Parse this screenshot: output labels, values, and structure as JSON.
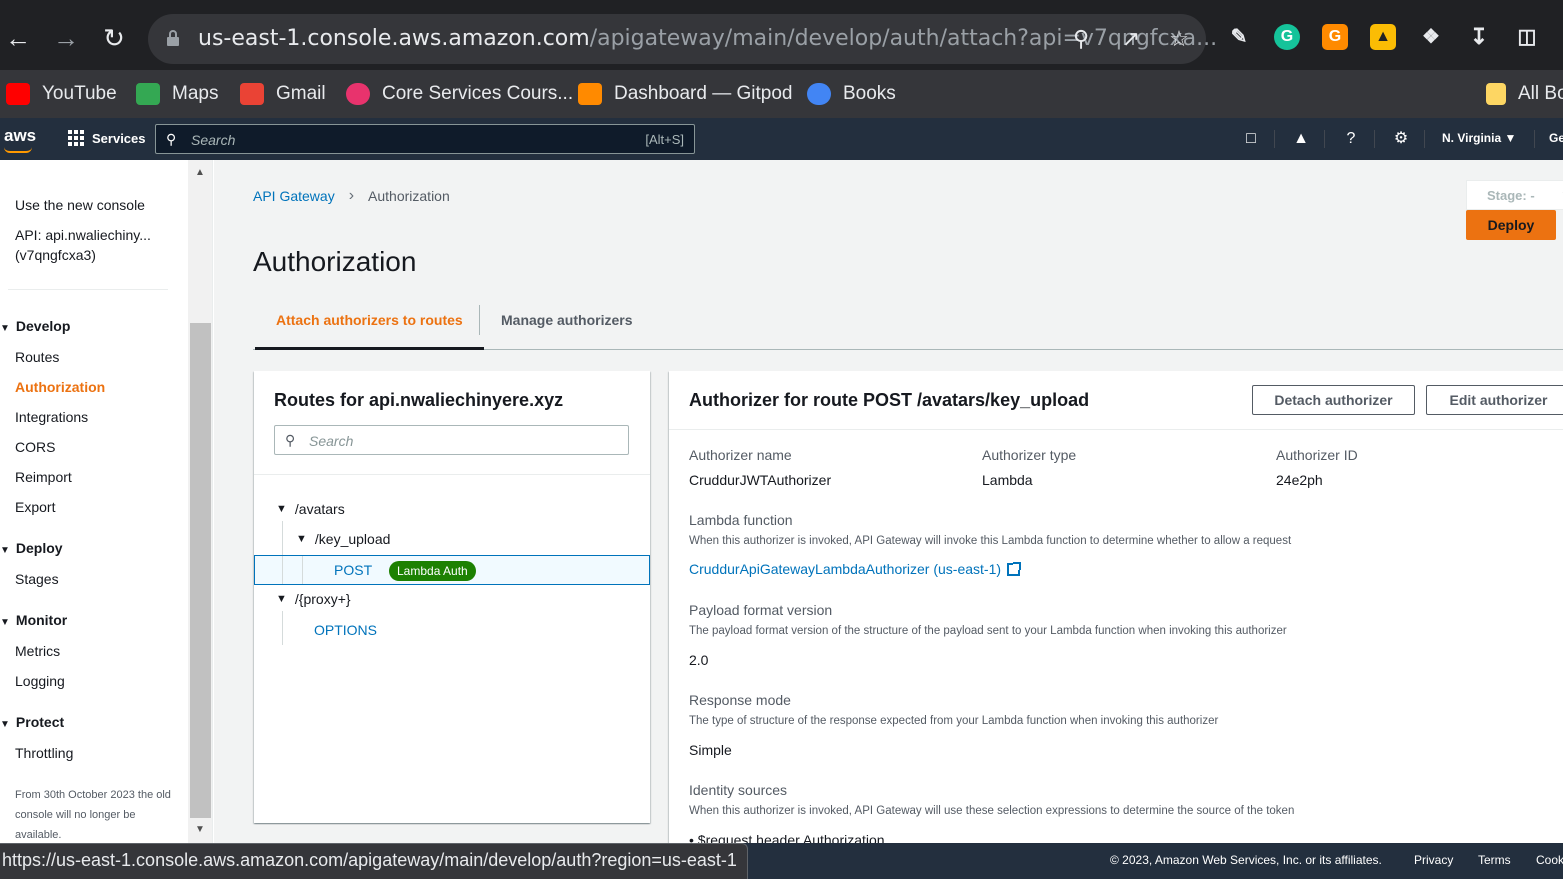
{
  "browser": {
    "url_host": "us-east-1.console.aws.amazon.com",
    "url_path": "/apigateway/main/develop/auth/attach?api=v7qngfcxa...",
    "status_url": "https://us-east-1.console.aws.amazon.com/apigateway/main/develop/auth?region=us-east-1"
  },
  "bookmarks": [
    {
      "label": "YouTube",
      "color": "#ff0000"
    },
    {
      "label": "Maps",
      "color": "#34a853"
    },
    {
      "label": "Gmail",
      "color": "#ea4335"
    },
    {
      "label": "Core Services Cours...",
      "color": "#e8336d"
    },
    {
      "label": "Dashboard — Gitpod",
      "color": "#ff8a00"
    },
    {
      "label": "Books",
      "color": "#4285f4"
    },
    {
      "label": "All Bo",
      "color": "#fdd663"
    }
  ],
  "aws": {
    "logo": "aws",
    "services": "Services",
    "search_placeholder": "Search",
    "search_shortcut": "[Alt+S]",
    "region": "N. Virginia ▼",
    "account": "Ge"
  },
  "sidebar": {
    "new_console": "Use the new console",
    "api_name_line1": "API: api.nwaliechiny...",
    "api_name_line2": "(v7qngfcxa3)",
    "sections": [
      {
        "title": "Develop",
        "items": [
          "Routes",
          "Authorization",
          "Integrations",
          "CORS",
          "Reimport",
          "Export"
        ]
      },
      {
        "title": "Deploy",
        "items": [
          "Stages"
        ]
      },
      {
        "title": "Monitor",
        "items": [
          "Metrics",
          "Logging"
        ]
      },
      {
        "title": "Protect",
        "items": [
          "Throttling"
        ]
      }
    ],
    "note": "From 30th October 2023 the old console will no longer be available."
  },
  "main": {
    "breadcrumb_root": "API Gateway",
    "breadcrumb_current": "Authorization",
    "title": "Authorization",
    "stage_label": "Stage: -",
    "deploy": "Deploy",
    "tabs": [
      "Attach authorizers to routes",
      "Manage authorizers"
    ]
  },
  "routes": {
    "title": "Routes for api.nwaliechinyere.xyz",
    "search_placeholder": "Search",
    "tree": {
      "avatars": "/avatars",
      "key_upload": "/key_upload",
      "post": "POST",
      "badge": "Lambda Auth",
      "proxy": "/{proxy+}",
      "options": "OPTIONS"
    }
  },
  "authorizer": {
    "title": "Authorizer for route POST /avatars/key_upload",
    "detach": "Detach authorizer",
    "edit": "Edit authorizer",
    "name_label": "Authorizer name",
    "name_value": "CruddurJWTAuthorizer",
    "type_label": "Authorizer type",
    "type_value": "Lambda",
    "id_label": "Authorizer ID",
    "id_value": "24e2ph",
    "lambda_label": "Lambda function",
    "lambda_desc": "When this authorizer is invoked, API Gateway will invoke this Lambda function to determine whether to allow a request",
    "lambda_link": "CruddurApiGatewayLambdaAuthorizer (us-east-1)",
    "payload_label": "Payload format version",
    "payload_desc": "The payload format version of the structure of the payload sent to your Lambda function when invoking this authorizer",
    "payload_value": "2.0",
    "response_label": "Response mode",
    "response_desc": "The type of structure of the response expected from your Lambda function when invoking this authorizer",
    "response_value": "Simple",
    "identity_label": "Identity sources",
    "identity_desc": "When this authorizer is invoked, API Gateway will use these selection expressions to determine the source of the token",
    "identity_value": "$request.header.Authorization"
  },
  "footer": {
    "copyright": "© 2023, Amazon Web Services, Inc. or its affiliates.",
    "privacy": "Privacy",
    "terms": "Terms",
    "cookie": "Cook"
  }
}
